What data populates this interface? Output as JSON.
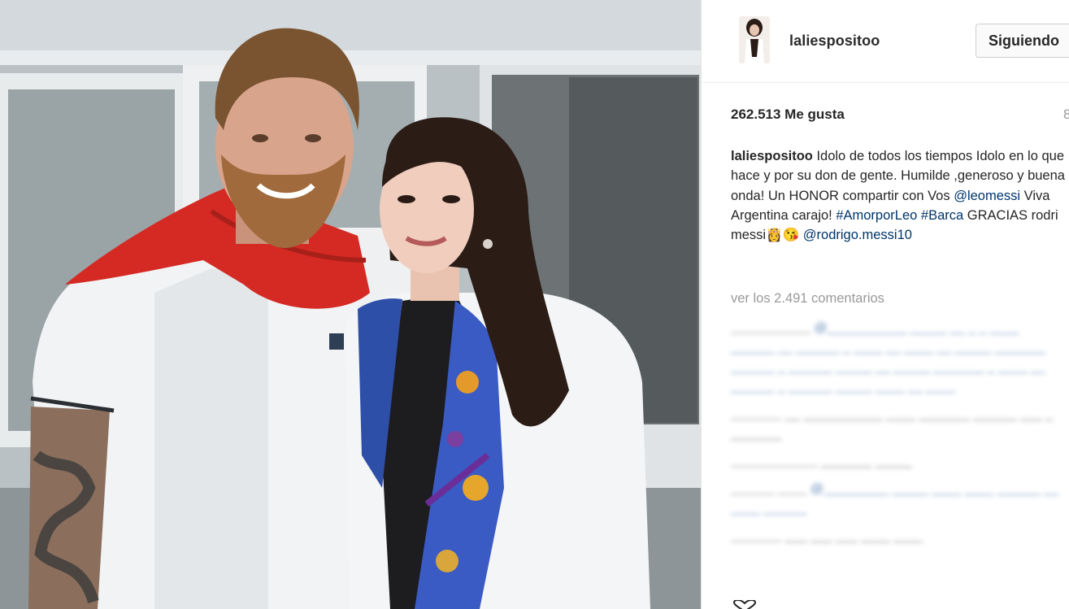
{
  "post": {
    "username": "laliespositoo",
    "follow_label": "Siguiendo",
    "likes": "262.513 Me gusta",
    "time_ago": "8",
    "caption": {
      "username": "laliespositoo",
      "text_1": "Idolo de todos los tiempos Idolo en lo que hace y por su don de gente. Humilde ,generoso y buena onda! Un HONOR compartir con Vos ",
      "mention_1": "@leomessi",
      "text_2": " Viva Argentina carajo! ",
      "hashtag_1": "#AmorporLeo",
      "text_3": " ",
      "hashtag_2": "#Barca",
      "text_4": " GRACIAS rodri messi",
      "emoji": "👸😘",
      "text_5": " ",
      "mention_2": "@rodrigo.messi10"
    },
    "view_comments": "ver los 2.491 comentarios"
  },
  "comments_blurred": [
    {
      "user": "___________",
      "text": "@___________ _____ __ _ _ ____ ______ __ ______ _ ____ __ ____ __ _____ _______ ______ _ ______ _____ __ _____ _______ _ ____ __ ______ _ ______ _____ ____ __ ____"
    },
    {
      "user": "_______",
      "text": "__ ___________ ____ _______ ______ ___ _ _______"
    },
    {
      "user": "____________",
      "text": "_______ _____"
    },
    {
      "user": "______ ____",
      "text": "@_________ _____ ____ ____ ______ __ ____ ______"
    },
    {
      "user": "_______",
      "text": "___ ___ ___ ____ ____"
    }
  ],
  "icons": {
    "avatar": "profile-photo",
    "heart": "heart-icon"
  },
  "colors": {
    "scarf": "#d52a23",
    "link": "#003569",
    "muted": "#999999"
  }
}
